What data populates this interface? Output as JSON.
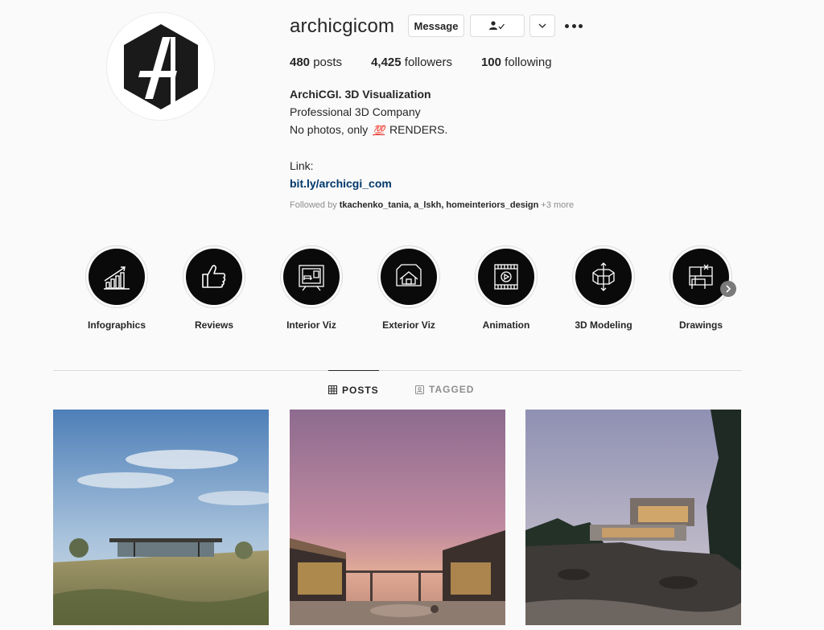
{
  "profile": {
    "username": "archicgicom",
    "avatar_icon": "archicgi-logo-icon",
    "buttons": {
      "message": "Message",
      "following_icon": "person-check-icon",
      "dropdown_icon": "chevron-down-icon",
      "more_icon": "more-options-icon"
    },
    "stats": {
      "posts_count": "480",
      "posts_label": "posts",
      "followers_count": "4,425",
      "followers_label": "followers",
      "following_count": "100",
      "following_label": "following"
    },
    "bio": {
      "name": "ArchiCGI. 3D Visualization",
      "line1": "Professional 3D Company",
      "line2_before": "No photos, only",
      "line2_emoji": "💯",
      "line2_after": "RENDERS.",
      "link_label": "Link:",
      "link": "bit.ly/archicgi_com"
    },
    "followed_by": {
      "prefix": "Followed by",
      "names": "tkachenko_tania, a_lskh, homeinteriors_design",
      "more": "+3 more"
    }
  },
  "highlights": [
    {
      "label": "Infographics",
      "icon": "bar-chart-icon"
    },
    {
      "label": "Reviews",
      "icon": "thumbs-up-icon"
    },
    {
      "label": "Interior Viz",
      "icon": "interior-room-icon"
    },
    {
      "label": "Exterior Viz",
      "icon": "house-exterior-icon"
    },
    {
      "label": "Animation",
      "icon": "film-play-icon"
    },
    {
      "label": "3D Modeling",
      "icon": "3d-model-icon"
    },
    {
      "label": "Drawings",
      "icon": "blueprint-icon"
    }
  ],
  "tabs": {
    "posts": "POSTS",
    "tagged": "TAGGED"
  },
  "posts": [
    {
      "name": "post-desert-house"
    },
    {
      "name": "post-sunset-courtyard"
    },
    {
      "name": "post-cliff-house"
    }
  ],
  "colors": {
    "background": "#fafafa",
    "text": "#262626",
    "muted": "#8e8e8e",
    "link": "#00376b",
    "highlight_fill": "#0a0a0a"
  }
}
